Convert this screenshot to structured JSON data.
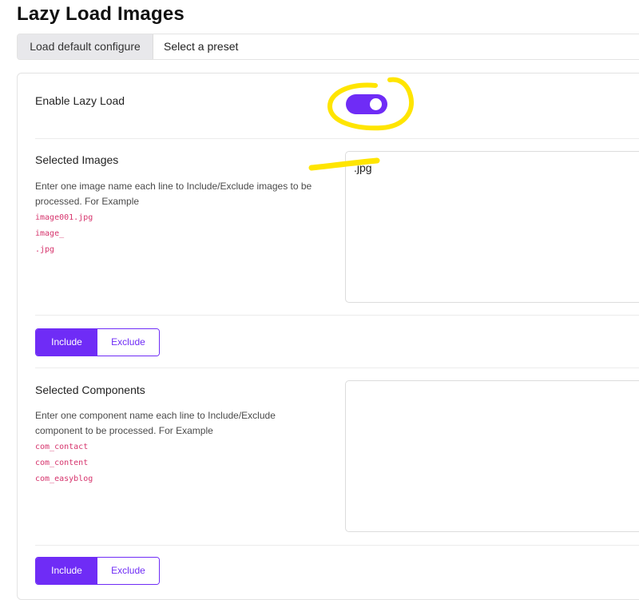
{
  "page": {
    "title": "Lazy Load Images"
  },
  "preset": {
    "load_default_label": "Load default configure",
    "select_label": "Select a preset"
  },
  "enable": {
    "label": "Enable Lazy Load",
    "enabled": true,
    "accent_color": "#6f2cf6"
  },
  "images": {
    "label": "Selected Images",
    "description": "Enter one image name each line to Include/Exclude images to be processed. For Example",
    "examples": [
      "image001.jpg",
      "image_",
      ".jpg"
    ],
    "value": ".jpg",
    "include_label": "Include",
    "exclude_label": "Exclude",
    "selected": "Include"
  },
  "components": {
    "label": "Selected Components",
    "description": "Enter one component name each line to Include/Exclude component to be processed. For Example",
    "examples": [
      "com_contact",
      "com_content",
      "com_easyblog"
    ],
    "value": "",
    "include_label": "Include",
    "exclude_label": "Exclude",
    "selected": "Include"
  },
  "annotation_color": "#ffe500"
}
